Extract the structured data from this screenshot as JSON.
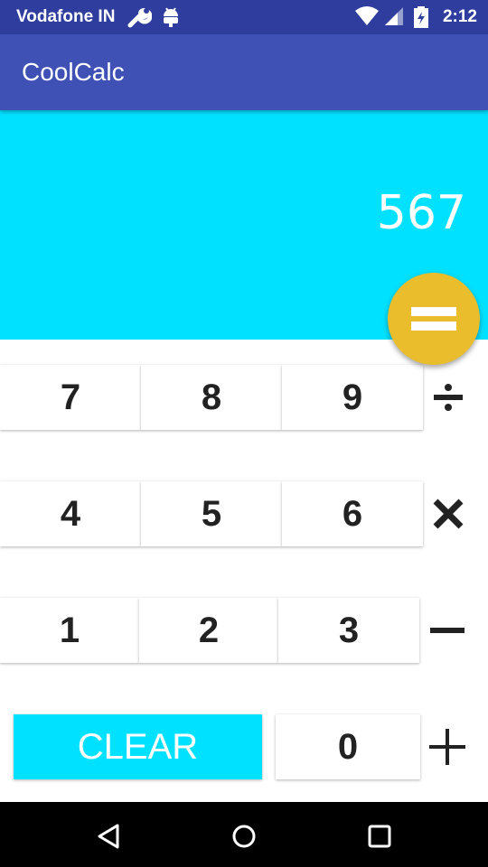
{
  "status_bar": {
    "carrier": "Vodafone IN",
    "time": "2:12",
    "icons": [
      "wrench-icon",
      "android-icon",
      "wifi-icon",
      "signal-icon",
      "battery-icon"
    ]
  },
  "app_bar": {
    "title": "CoolCalc",
    "color": "#3f51b5"
  },
  "display": {
    "value": "567",
    "background": "#00e0ff"
  },
  "equals_button": {
    "icon": "equals-icon",
    "color": "#e9bd2c"
  },
  "keypad": {
    "rows": [
      [
        "7",
        "8",
        "9"
      ],
      [
        "4",
        "5",
        "6"
      ],
      [
        "1",
        "2",
        "3"
      ]
    ],
    "clear_label": "CLEAR",
    "zero_label": "0",
    "operators": [
      "divide-icon",
      "multiply-icon",
      "minus-icon",
      "plus-icon"
    ]
  },
  "nav_bar": {
    "icons": [
      "back-icon",
      "home-icon",
      "recents-icon"
    ]
  }
}
